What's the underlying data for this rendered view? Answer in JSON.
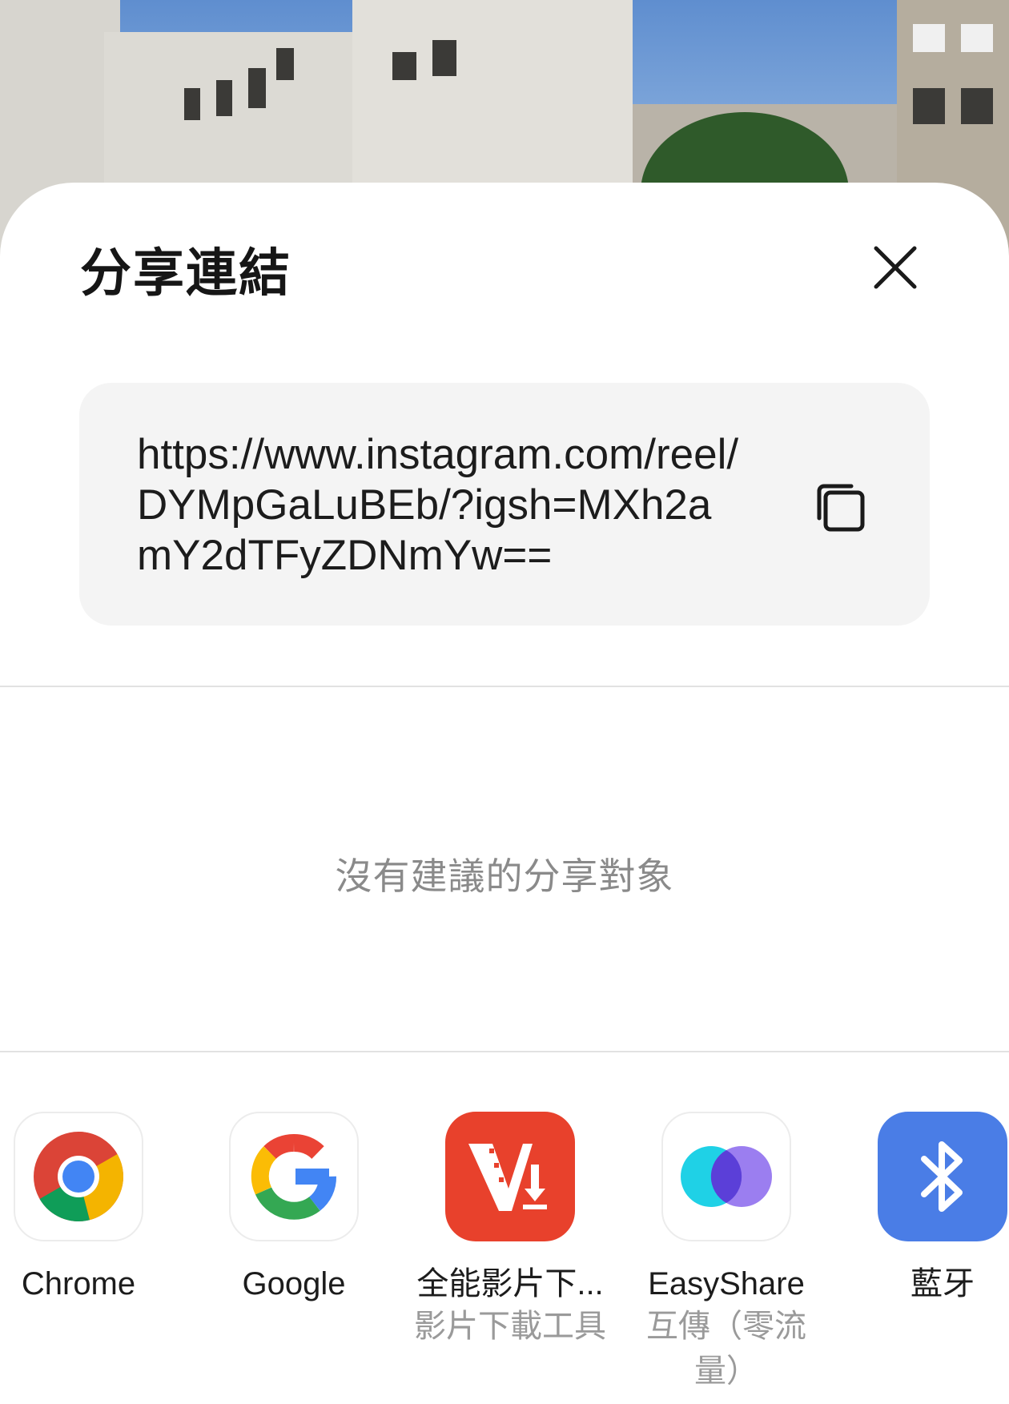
{
  "sheet": {
    "title": "分享連結",
    "close_icon": "close-icon",
    "link": {
      "url": "https://www.instagram.com/reel/DYMpGaLuBEb/?igsh=MXh2amY2dTFyZDNmYw==",
      "copy_icon": "copy-icon"
    },
    "no_suggestions_text": "沒有建議的分享對象",
    "apps": [
      {
        "label": "Chrome",
        "sublabel": "",
        "icon": "chrome-icon"
      },
      {
        "label": "Google",
        "sublabel": "",
        "icon": "google-icon"
      },
      {
        "label": "全能影片下...",
        "sublabel": "影片下載工具",
        "icon": "video-downloader-icon",
        "color": "#e8412c"
      },
      {
        "label": "EasyShare",
        "sublabel": "互傳（零流量）",
        "icon": "easyshare-icon"
      },
      {
        "label": "藍牙",
        "sublabel": "",
        "icon": "bluetooth-icon",
        "color": "#4a7de6"
      }
    ]
  }
}
